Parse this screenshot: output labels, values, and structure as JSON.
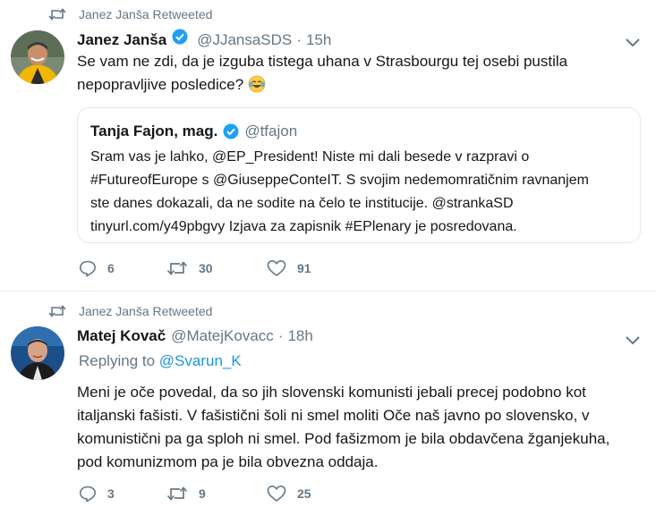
{
  "tweets": [
    {
      "retweeted_by": "Janez Janša Retweeted",
      "author": {
        "name": "Janez Janša",
        "handle": "@JJansaSDS",
        "separator": "·",
        "time": "15h",
        "verified": true
      },
      "text_lines": [
        "Se vam ne zdi, da je izguba tistega uhana v Strasbourgu tej osebi pustila",
        "nepopravljive posledice?"
      ],
      "emoji": "face-with-tears-of-joy",
      "quote": {
        "name": "Tanja Fajon, mag.",
        "handle": "@tfajon",
        "verified": true,
        "lines": [
          "Sram vas je lahko, @EP_President! Niste mi dali besede v razpravi o",
          "#FutureofEurope s @GiuseppeConteIT. S svojim nedemomratičnim ravnanjem",
          "ste danes dokazali, da ne sodite na čelo te institucije. @strankaSD",
          "tinyurl.com/y49pbgvy Izjava za zapisnik #EPlenary je posredovana."
        ]
      },
      "actions": {
        "replies": "6",
        "retweets": "30",
        "likes": "91"
      }
    },
    {
      "retweeted_by": "Janez Janša Retweeted",
      "author": {
        "name": "Matej Kovač",
        "handle": "@MatejKovacc",
        "separator": "·",
        "time": "18h",
        "verified": false
      },
      "replying_prefix": "Replying to",
      "replying_to": "@Svarun_K",
      "text_lines": [
        "Meni je oče povedal, da so jih slovenski komunisti jebali precej podobno kot",
        "italjanski fašisti. V fašistični šoli ni smel moliti Oče naš javno po slovensko, v",
        "komunistični pa ga sploh ni smel. Pod fašizmom je bila obdavčena žganjekuha,",
        "pod komunizmom pa je bila obvezna oddaja."
      ],
      "actions": {
        "replies": "3",
        "retweets": "9",
        "likes": "25"
      }
    }
  ],
  "colors": {
    "text": "#14171a",
    "secondary": "#657786",
    "link": "#1b95e0",
    "border": "#e6ecf0",
    "verified": "#1da1f2"
  }
}
